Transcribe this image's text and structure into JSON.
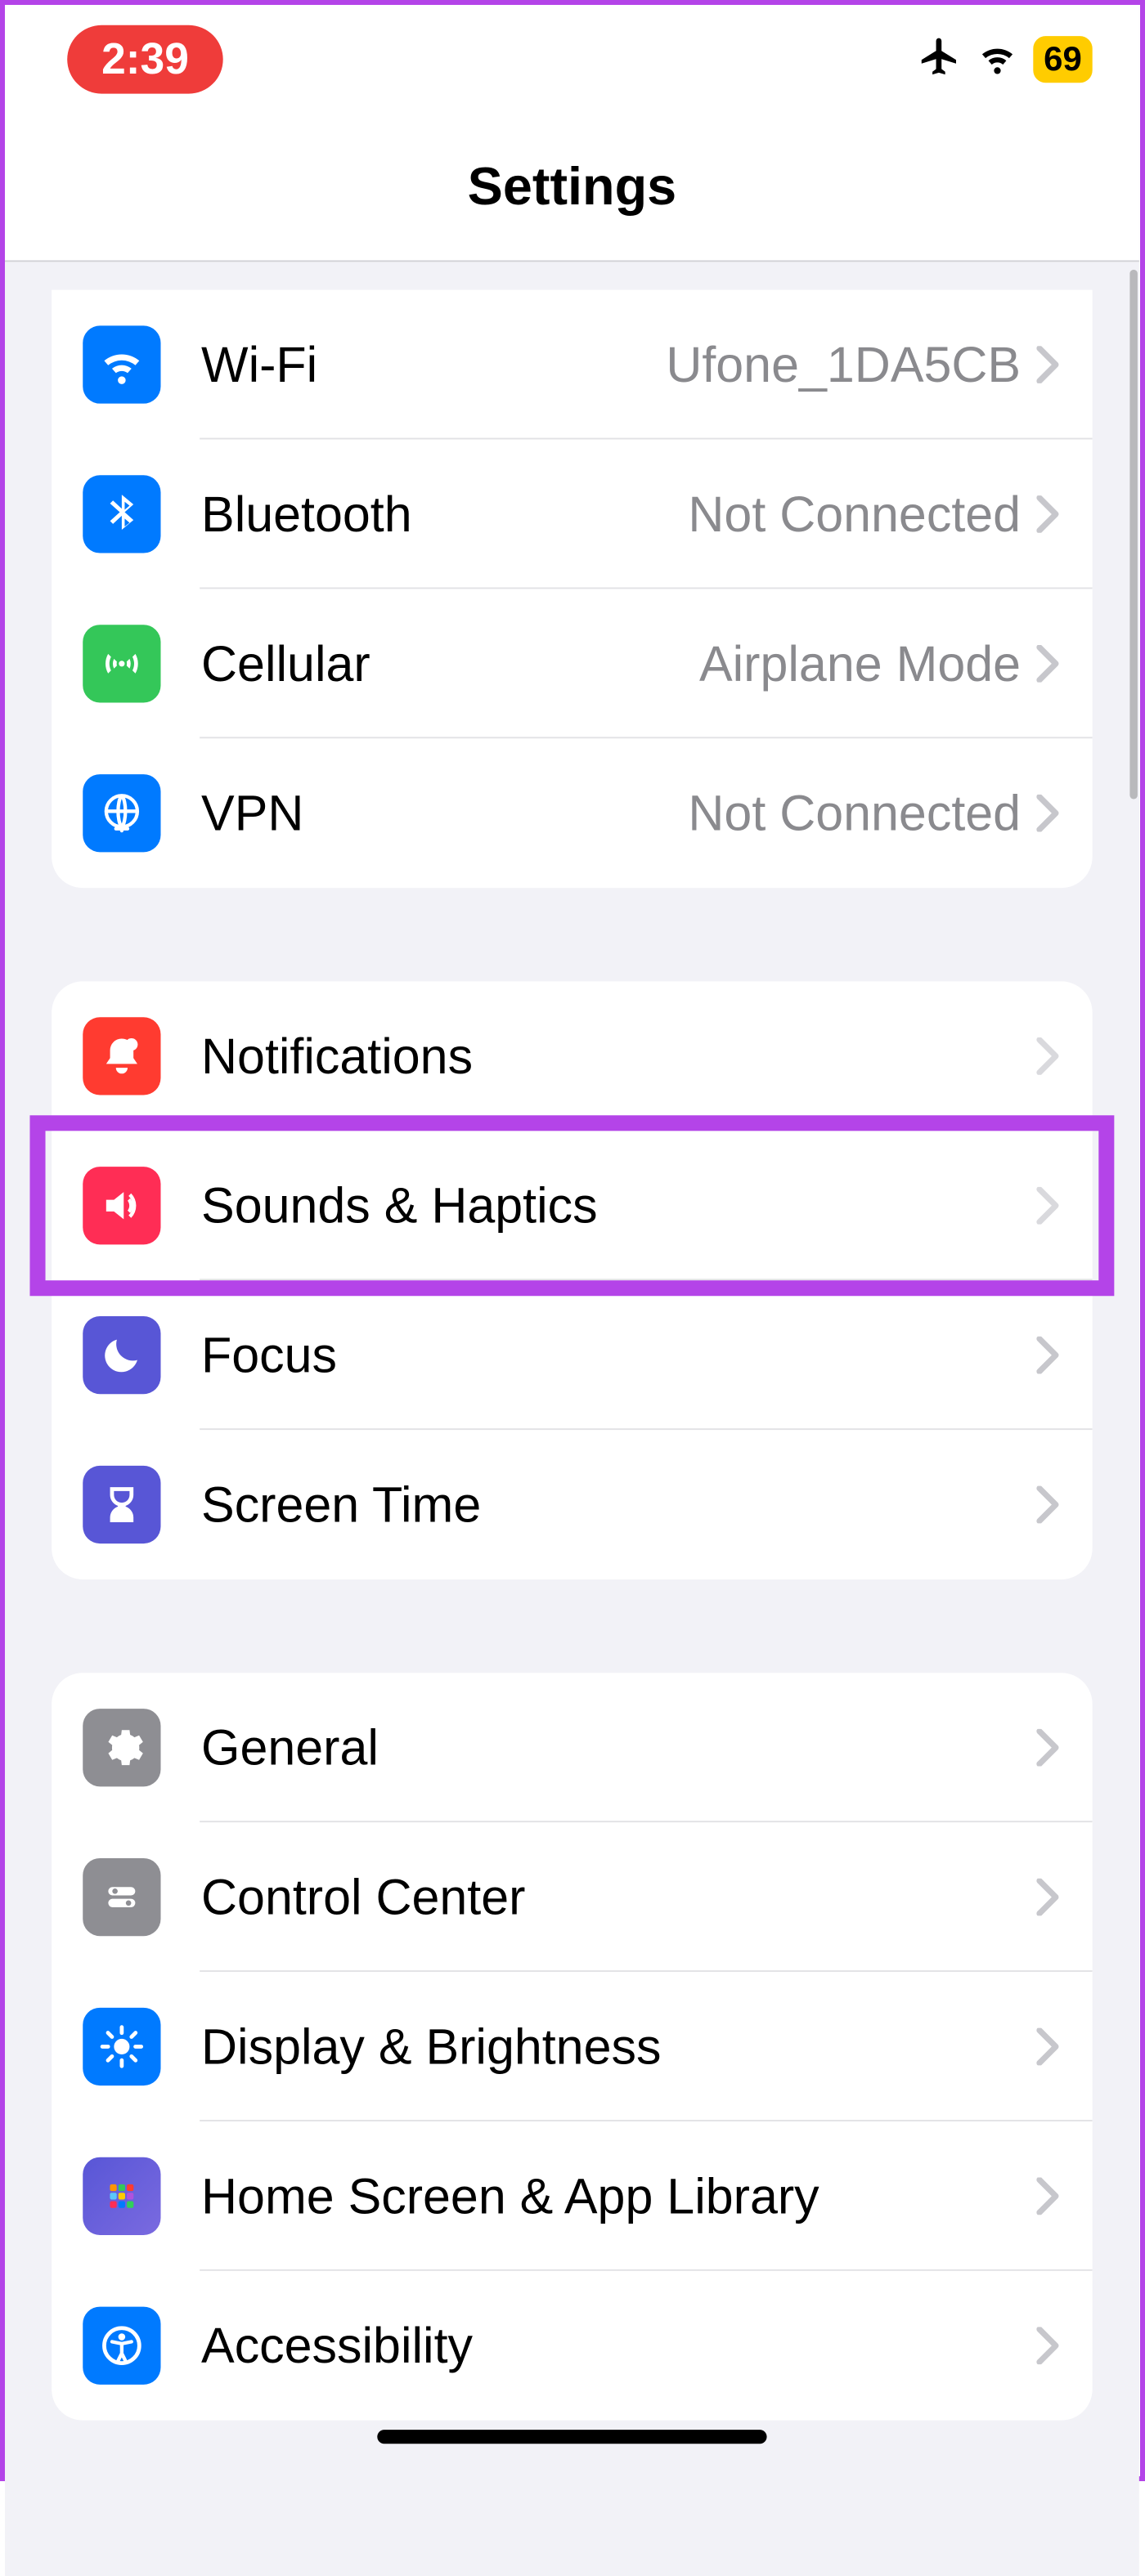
{
  "statusBar": {
    "time": "2:39",
    "battery": "69"
  },
  "header": {
    "title": "Settings"
  },
  "groups": [
    {
      "rows": [
        {
          "icon": "wifi",
          "iconBg": "bg-blue",
          "label": "Wi-Fi",
          "value": "Ufone_1DA5CB"
        },
        {
          "icon": "bluetooth",
          "iconBg": "bg-blue",
          "label": "Bluetooth",
          "value": "Not Connected"
        },
        {
          "icon": "cellular",
          "iconBg": "bg-green",
          "label": "Cellular",
          "value": "Airplane Mode"
        },
        {
          "icon": "vpn",
          "iconBg": "bg-blue",
          "label": "VPN",
          "value": "Not Connected"
        }
      ]
    },
    {
      "rows": [
        {
          "icon": "notifications",
          "iconBg": "bg-red",
          "label": "Notifications",
          "value": ""
        },
        {
          "icon": "sounds",
          "iconBg": "bg-pinkred",
          "label": "Sounds & Haptics",
          "value": "",
          "highlighted": true
        },
        {
          "icon": "focus",
          "iconBg": "bg-indigo",
          "label": "Focus",
          "value": ""
        },
        {
          "icon": "screentime",
          "iconBg": "bg-indigo",
          "label": "Screen Time",
          "value": ""
        }
      ]
    },
    {
      "rows": [
        {
          "icon": "general",
          "iconBg": "bg-gray",
          "label": "General",
          "value": ""
        },
        {
          "icon": "controlcenter",
          "iconBg": "bg-gray",
          "label": "Control Center",
          "value": ""
        },
        {
          "icon": "display",
          "iconBg": "bg-blue",
          "label": "Display & Brightness",
          "value": ""
        },
        {
          "icon": "homescreen",
          "iconBg": "bg-gradient-home",
          "label": "Home Screen & App Library",
          "value": ""
        },
        {
          "icon": "accessibility",
          "iconBg": "bg-blue",
          "label": "Accessibility",
          "value": ""
        }
      ]
    }
  ]
}
